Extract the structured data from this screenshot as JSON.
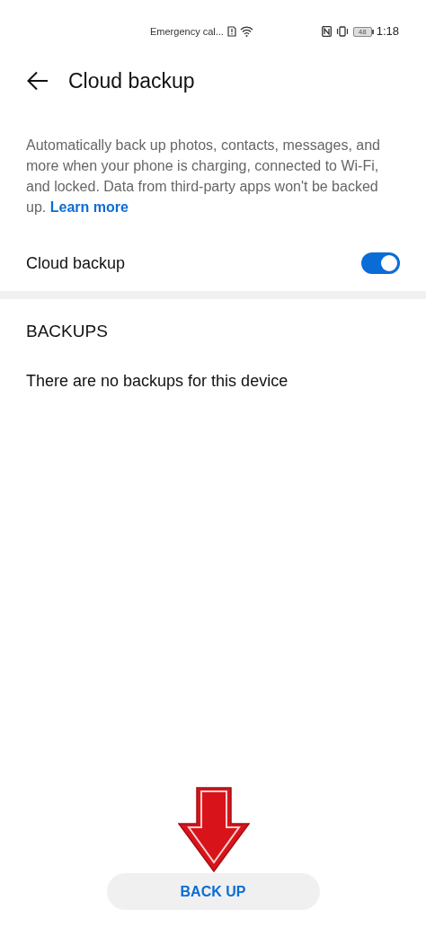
{
  "status_bar": {
    "carrier": "Emergency cal...",
    "battery": "48",
    "time": "1:18"
  },
  "header": {
    "title": "Cloud backup"
  },
  "description": {
    "text": "Automatically back up photos, contacts, messages, and more when your phone is charging, connected to Wi-Fi, and locked. Data from third-party apps won't be backed up.",
    "link": "Learn more"
  },
  "setting": {
    "label": "Cloud backup",
    "on": true
  },
  "backups": {
    "heading": "BACKUPS",
    "empty_text": "There are no backups for this device"
  },
  "button": {
    "label": "BACK UP"
  }
}
